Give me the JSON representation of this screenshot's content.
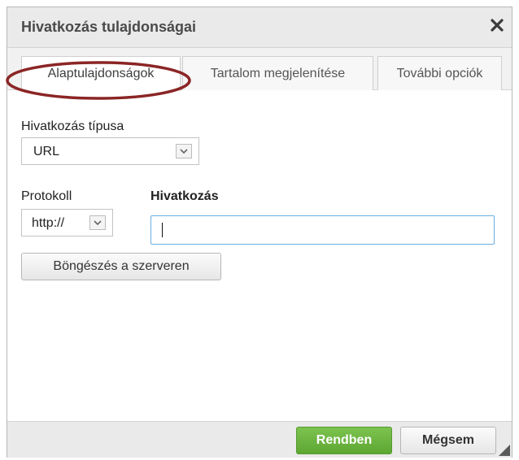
{
  "dialog": {
    "title": "Hivatkozás tulajdonságai",
    "close_icon": "close-x-icon"
  },
  "tabs": [
    {
      "label": "Alaptulajdonságok",
      "active": true
    },
    {
      "label": "Tartalom megjelenítése",
      "active": false
    },
    {
      "label": "További opciók",
      "active": false
    }
  ],
  "form": {
    "link_type_label": "Hivatkozás típusa",
    "link_type_value": "URL",
    "protocol_label": "Protokoll",
    "protocol_value": "http://",
    "link_label": "Hivatkozás",
    "link_value": "",
    "browse_button": "Böngészés a szerveren"
  },
  "footer": {
    "ok_label": "Rendben",
    "cancel_label": "Mégsem"
  },
  "colors": {
    "ok_button": "#6ab33f",
    "highlight_ellipse": "#8b2525",
    "input_focus_border": "#69aee5"
  }
}
